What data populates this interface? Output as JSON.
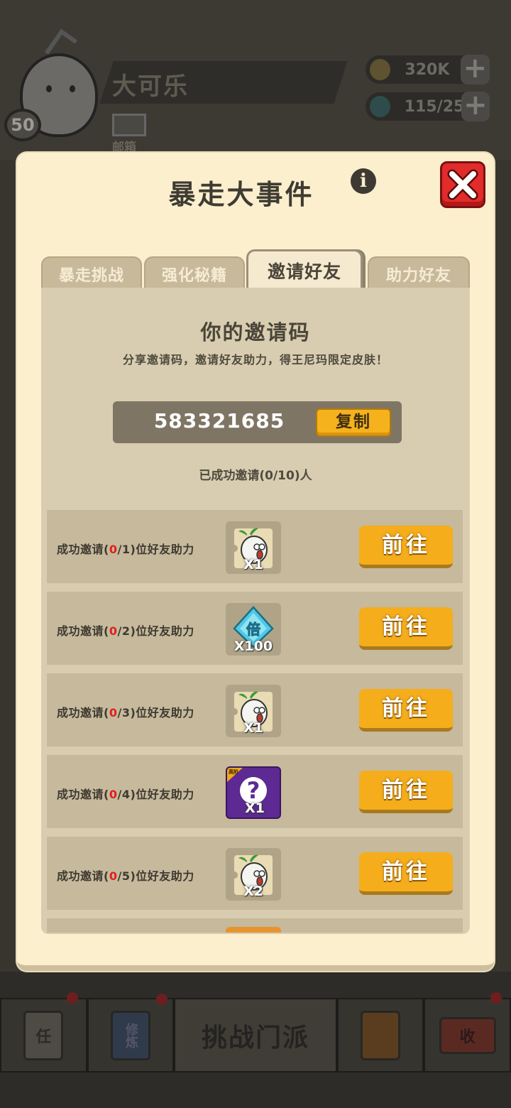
{
  "background": {
    "player_name": "大可乐",
    "level": "50",
    "mail_label": "邮箱",
    "coins": "320K",
    "gems": "115/25",
    "nav": {
      "task": "任",
      "train": "修炼",
      "challenge": "挑战门派",
      "collect": "收"
    }
  },
  "modal": {
    "title": "暴走大事件",
    "info_glyph": "i",
    "tabs": [
      "暴走挑战",
      "强化秘籍",
      "邀请好友",
      "助力好友"
    ],
    "active_tab": 2,
    "panel": {
      "title": "你的邀请码",
      "subtitle": "分享邀请码，邀请好友助力，得王尼玛限定皮肤！",
      "code": "583321685",
      "copy_label": "复制",
      "invited_status": "已成功邀请(0/10)人"
    },
    "rewards": [
      {
        "prefix": "成功邀请(",
        "done": "0",
        "suffix": "/1)位好友助力",
        "item": "radish",
        "qty": "X1",
        "button": "前往"
      },
      {
        "prefix": "成功邀请(",
        "done": "0",
        "suffix": "/2)位好友助力",
        "item": "diamond",
        "item_glyph": "倍",
        "qty": "X100",
        "button": "前往"
      },
      {
        "prefix": "成功邀请(",
        "done": "0",
        "suffix": "/3)位好友助力",
        "item": "radish",
        "qty": "X1",
        "button": "前往"
      },
      {
        "prefix": "成功邀请(",
        "done": "0",
        "suffix": "/4)位好友助力",
        "item": "mystery",
        "item_tag": "高阶",
        "qty": "X1",
        "button": "前往"
      },
      {
        "prefix": "成功邀请(",
        "done": "0",
        "suffix": "/5)位好友助力",
        "item": "radish",
        "qty": "X2",
        "button": "前往"
      }
    ]
  },
  "colors": {
    "modal_bg": "#fbefce",
    "panel_bg": "#d8cdb0",
    "row_bg": "#c6b99c",
    "button_orange": "#f5ad1b",
    "close_red": "#e22b2b",
    "progress_red": "#e02020"
  }
}
